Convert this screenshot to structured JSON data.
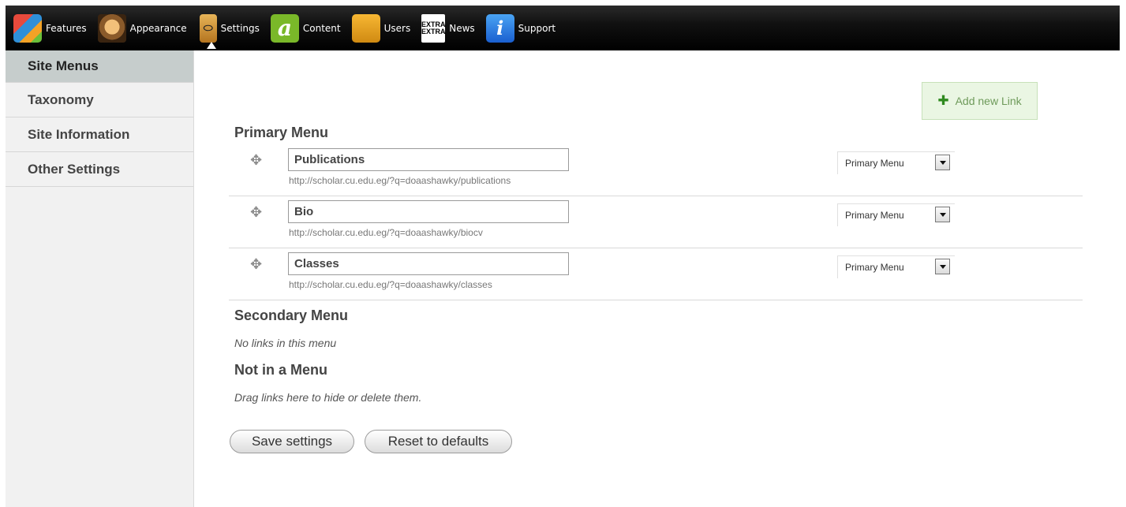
{
  "toolbar": {
    "items": [
      {
        "label": "Features",
        "icon": "puzzle-icon"
      },
      {
        "label": "Appearance",
        "icon": "mona-lisa-icon"
      },
      {
        "label": "Settings",
        "icon": "settings-icon",
        "active": true
      },
      {
        "label": "Content",
        "icon": "content-a-icon"
      },
      {
        "label": "Users",
        "icon": "users-icon"
      },
      {
        "label": "News",
        "icon": "extra-extra-icon",
        "icon_text": "EXTRA EXTRA"
      },
      {
        "label": "Support",
        "icon": "info-icon",
        "icon_text": "i"
      }
    ]
  },
  "sidebar": {
    "items": [
      {
        "label": "Site Menus",
        "active": true
      },
      {
        "label": "Taxonomy"
      },
      {
        "label": "Site Information"
      },
      {
        "label": "Other Settings"
      }
    ]
  },
  "main": {
    "add_link_label": "Add new Link",
    "primary_menu_title": "Primary Menu",
    "links": [
      {
        "title": "Publications",
        "url": "http://scholar.cu.edu.eg/?q=doaashawky/publications",
        "menu": "Primary Menu"
      },
      {
        "title": "Bio",
        "url": "http://scholar.cu.edu.eg/?q=doaashawky/biocv",
        "menu": "Primary Menu"
      },
      {
        "title": "Classes",
        "url": "http://scholar.cu.edu.eg/?q=doaashawky/classes",
        "menu": "Primary Menu"
      }
    ],
    "secondary_menu_title": "Secondary Menu",
    "secondary_empty": "No links in this menu",
    "not_in_menu_title": "Not in a Menu",
    "not_in_menu_note": "Drag links here to hide or delete them.",
    "save_label": "Save settings",
    "reset_label": "Reset to defaults"
  },
  "colors": {
    "toolbar_bg": "#000000",
    "sidebar_bg": "#f1f1f1",
    "sidebar_active_bg": "#c6cdcc",
    "add_link_bg": "#eaf6e3",
    "add_link_plus": "#2f8a1f"
  }
}
